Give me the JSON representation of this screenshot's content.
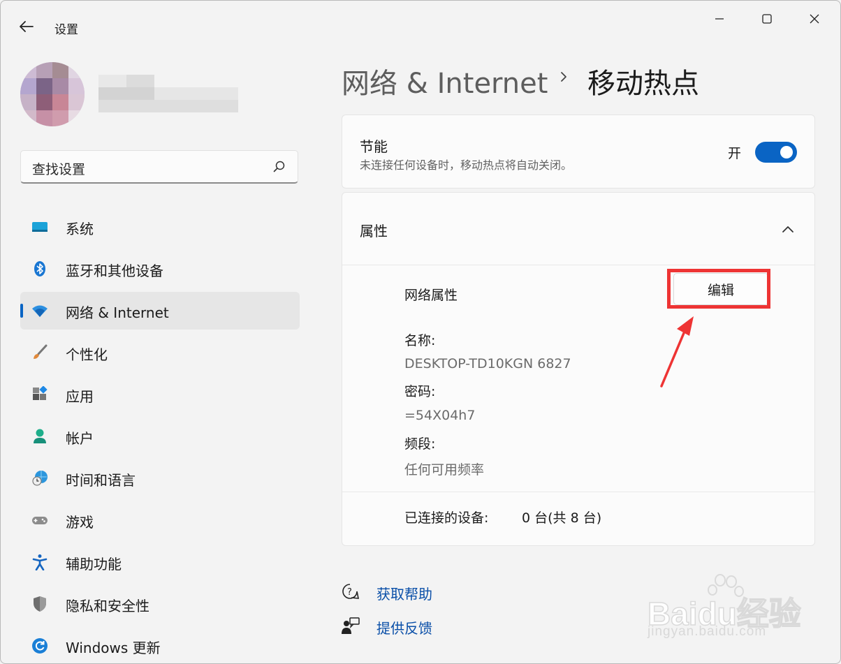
{
  "window": {
    "app_title": "设置"
  },
  "search": {
    "placeholder": "查找设置"
  },
  "nav": [
    {
      "label": "系统",
      "icon": "system-icon"
    },
    {
      "label": "蓝牙和其他设备",
      "icon": "bluetooth-icon"
    },
    {
      "label": "网络 & Internet",
      "icon": "wifi-icon",
      "selected": true
    },
    {
      "label": "个性化",
      "icon": "brush-icon"
    },
    {
      "label": "应用",
      "icon": "apps-icon"
    },
    {
      "label": "帐户",
      "icon": "account-icon"
    },
    {
      "label": "时间和语言",
      "icon": "time-language-icon"
    },
    {
      "label": "游戏",
      "icon": "gamepad-icon"
    },
    {
      "label": "辅助功能",
      "icon": "accessibility-icon"
    },
    {
      "label": "隐私和安全性",
      "icon": "shield-icon"
    },
    {
      "label": "Windows 更新",
      "icon": "update-icon"
    }
  ],
  "breadcrumb": {
    "parent": "网络 & Internet",
    "current": "移动热点"
  },
  "power_saving": {
    "title": "节能",
    "description": "未连接任何设备时，移动热点将自动关闭。",
    "toggle_label": "开",
    "toggle_on": true
  },
  "properties": {
    "title": "属性",
    "network_props_label": "网络属性",
    "edit_label": "编辑",
    "name_label": "名称:",
    "name_value": "DESKTOP-TD10KGN 6827",
    "password_label": "密码:",
    "password_value": "=54X04h7",
    "band_label": "频段:",
    "band_value": "任何可用频率",
    "connected_label": "已连接的设备:",
    "connected_value": "0 台(共 8 台)"
  },
  "links": {
    "help": "获取帮助",
    "feedback": "提供反馈"
  },
  "watermark": {
    "brand": "Baidu经验",
    "url": "jingyan.baidu.com"
  },
  "colors": {
    "accent": "#0a64c4",
    "annotation": "#ee3434",
    "link": "#0a4fa8"
  }
}
